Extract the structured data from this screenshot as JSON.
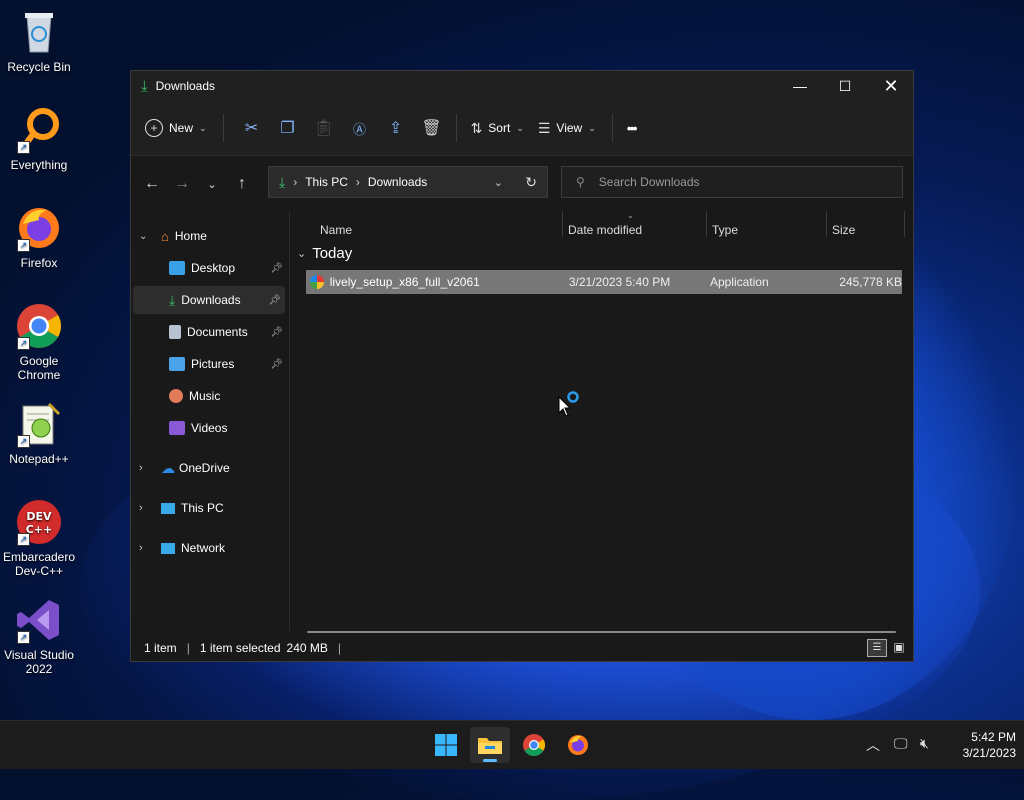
{
  "desktop": {
    "icons": [
      {
        "label": "Recycle Bin"
      },
      {
        "label": "Everything"
      },
      {
        "label": "Firefox"
      },
      {
        "label": "Google Chrome"
      },
      {
        "label": "Notepad++"
      },
      {
        "label": "Embarcadero Dev-C++"
      },
      {
        "label": "Visual Studio 2022"
      }
    ]
  },
  "window": {
    "title": "Downloads",
    "toolbar": {
      "new_label": "New",
      "sort_label": "Sort",
      "view_label": "View",
      "more_label": "•••"
    },
    "address": {
      "crumbs": [
        "This PC",
        "Downloads"
      ],
      "separator": "›"
    },
    "search": {
      "placeholder": "Search Downloads"
    },
    "sidebar": {
      "home": "Home",
      "quick": [
        {
          "label": "Desktop",
          "pinned": true,
          "color": "#3aa0e8"
        },
        {
          "label": "Downloads",
          "pinned": true,
          "color": "#39c06a"
        },
        {
          "label": "Documents",
          "pinned": true,
          "color": "#b8c3d1"
        },
        {
          "label": "Pictures",
          "pinned": true,
          "color": "#4aa3e8"
        },
        {
          "label": "Music",
          "pinned": false,
          "color": "#e07a5a"
        },
        {
          "label": "Videos",
          "pinned": false,
          "color": "#8a5ad6"
        }
      ],
      "onedrive": "OneDrive",
      "thispc": "This PC",
      "network": "Network"
    },
    "columns": {
      "name": "Name",
      "date": "Date modified",
      "type": "Type",
      "size": "Size"
    },
    "group": "Today",
    "files": [
      {
        "name": "lively_setup_x86_full_v2061",
        "date": "3/21/2023 5:40 PM",
        "type": "Application",
        "size": "245,778 KB"
      }
    ],
    "status": {
      "count": "1 item",
      "selected": "1 item selected",
      "size": "240 MB"
    }
  },
  "taskbar": {
    "time": "5:42 PM",
    "date": "3/21/2023"
  }
}
